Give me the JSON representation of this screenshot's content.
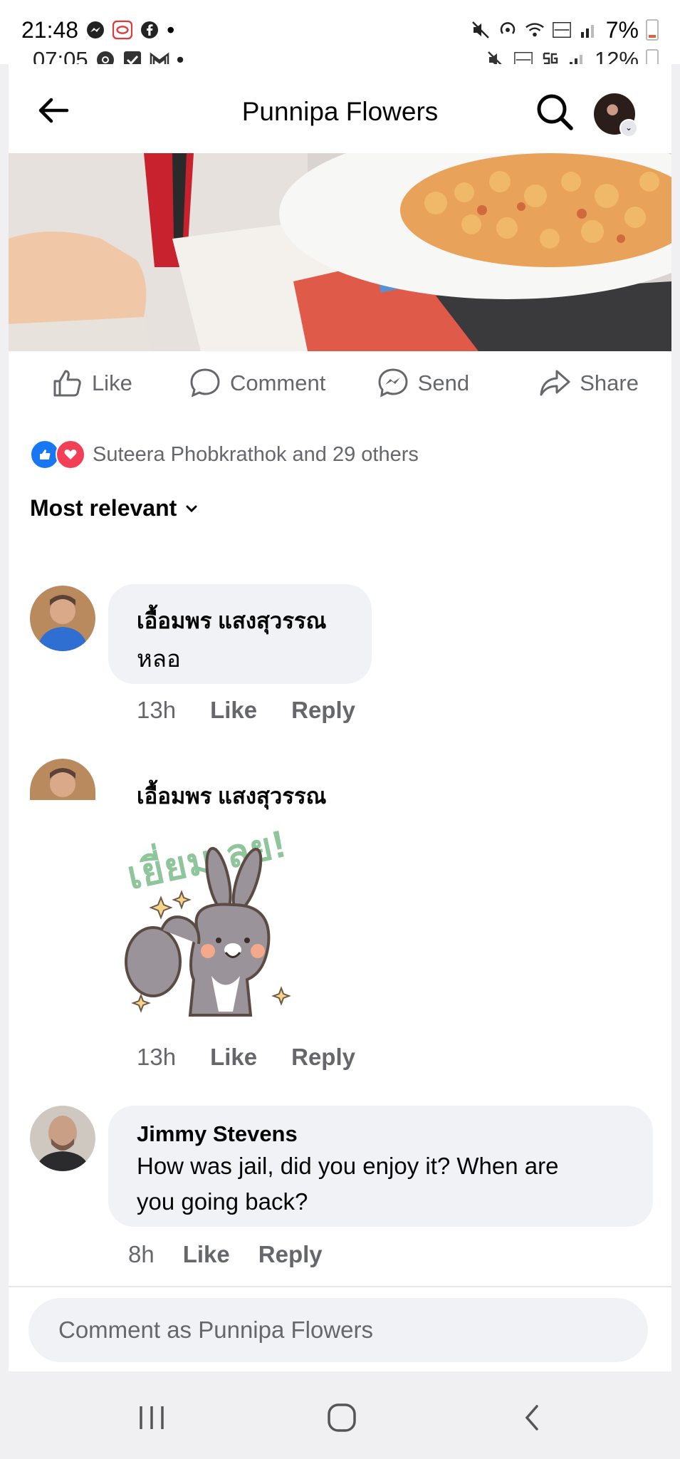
{
  "status_bar": {
    "time_primary": "21:48",
    "time_secondary": "07:05",
    "battery_primary": "7%",
    "battery_secondary": "12%"
  },
  "header": {
    "title": "Punnipa Flowers"
  },
  "post_actions": {
    "like": "Like",
    "comment": "Comment",
    "send": "Send",
    "share": "Share"
  },
  "reactions": {
    "summary": "Suteera Phobkrathok and 29 others"
  },
  "comments_sort": {
    "label": "Most relevant"
  },
  "comments": [
    {
      "author": "เอื้อมพร แสงสุวรรณ",
      "text": "หลอ",
      "time": "13h",
      "like": "Like",
      "reply": "Reply"
    },
    {
      "author": "เอื้อมพร แสงสุวรรณ",
      "sticker_text": "เยี่ยมเลย!",
      "time": "13h",
      "like": "Like",
      "reply": "Reply"
    },
    {
      "author": "Jimmy Stevens",
      "text_line1": "How was jail, did you enjoy it? When are",
      "text_line2": "you going back?",
      "time": "8h",
      "like": "Like",
      "reply": "Reply"
    }
  ],
  "composer": {
    "placeholder": "Comment as Punnipa Flowers"
  },
  "colors": {
    "accent_blue": "#1877f2",
    "love_red": "#f33e58",
    "muted_text": "#65676b",
    "bubble_bg": "#f0f2f5"
  }
}
